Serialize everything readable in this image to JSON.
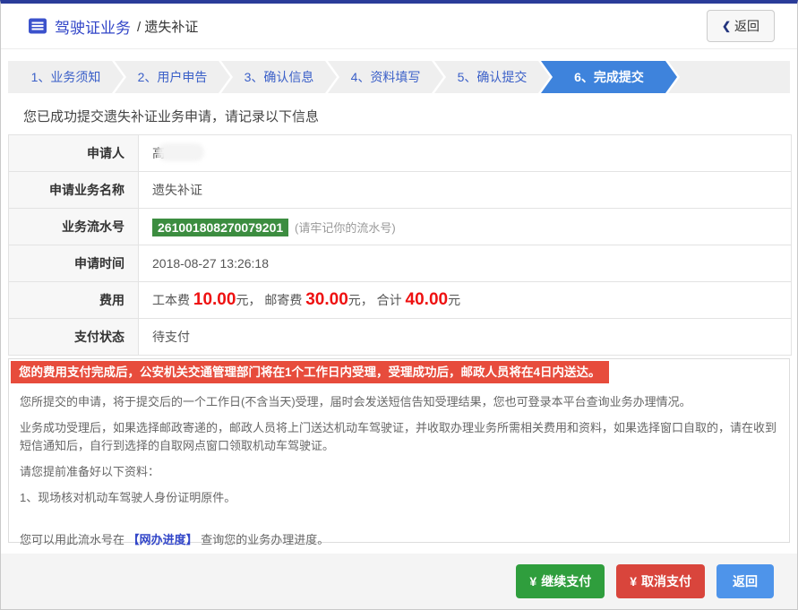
{
  "header": {
    "title": "驾驶证业务",
    "subtitle": "/ 遗失补证",
    "back_chevron": "❮",
    "back_label": "返回"
  },
  "steps": {
    "active_index": 5,
    "items": [
      {
        "label": "1、业务须知"
      },
      {
        "label": "2、用户申告"
      },
      {
        "label": "3、确认信息"
      },
      {
        "label": "4、资料填写"
      },
      {
        "label": "5、确认提交"
      },
      {
        "label": "6、完成提交"
      }
    ]
  },
  "main": {
    "success_message": "您已成功提交遗失补证业务申请，请记录以下信息",
    "info_table": {
      "rows": [
        {
          "label": "申请人",
          "value": "高",
          "redacted": true
        },
        {
          "label": "申请业务名称",
          "value": "遗失补证"
        },
        {
          "label": "业务流水号",
          "serial": "261001808270079201",
          "note": "(请牢记你的流水号)"
        },
        {
          "label": "申请时间",
          "value": "2018-08-27 13:26:18"
        },
        {
          "label": "费用",
          "fee_segments": [
            {
              "text": "工本费 "
            },
            {
              "text": "10.00"
            },
            {
              "text": "元， "
            },
            {
              "text": "邮寄费 "
            },
            {
              "text": "30.00"
            },
            {
              "text": "元， 合计 "
            },
            {
              "text": "40.00"
            },
            {
              "text": "元"
            }
          ]
        },
        {
          "label": "支付状态",
          "value": "待支付"
        }
      ]
    },
    "notice_banner": "您的费用支付完成后，公安机关交通管理部门将在1个工作日内受理，受理成功后，邮政人员将在4日内送达。",
    "paragraphs": [
      "您所提交的申请，将于提交后的一个工作日(不含当天)受理，届时会发送短信告知受理结果，您也可登录本平台查询业务办理情况。",
      "业务成功受理后，如果选择邮政寄递的，邮政人员将上门送达机动车驾驶证，并收取办理业务所需相关费用和资料，如果选择窗口自取的，请在收到短信通知后，自行到选择的自取网点窗口领取机动车驾驶证。",
      "请您提前准备好以下资料：",
      "1、现场核对机动车驾驶人身份证明原件。"
    ],
    "progress_line": {
      "prefix": "您可以用此流水号在 ",
      "link": "【网办进度】",
      "suffix": " 查询您的业务办理进度。"
    }
  },
  "footer": {
    "buttons": [
      {
        "icon": "¥",
        "label": "继续支付",
        "color": "#2f9e3d"
      },
      {
        "icon": "¥",
        "label": "取消支付",
        "color": "#d9453c"
      },
      {
        "icon": "",
        "label": "返回",
        "color": "#4e94ea"
      }
    ]
  },
  "colors": {
    "top_bar": "#2a3c99",
    "active_step": "#3e83dc",
    "serial_badge": "#3c8d40",
    "notice_banner": "#e74c3c",
    "fee_amount": "#ee1111"
  }
}
